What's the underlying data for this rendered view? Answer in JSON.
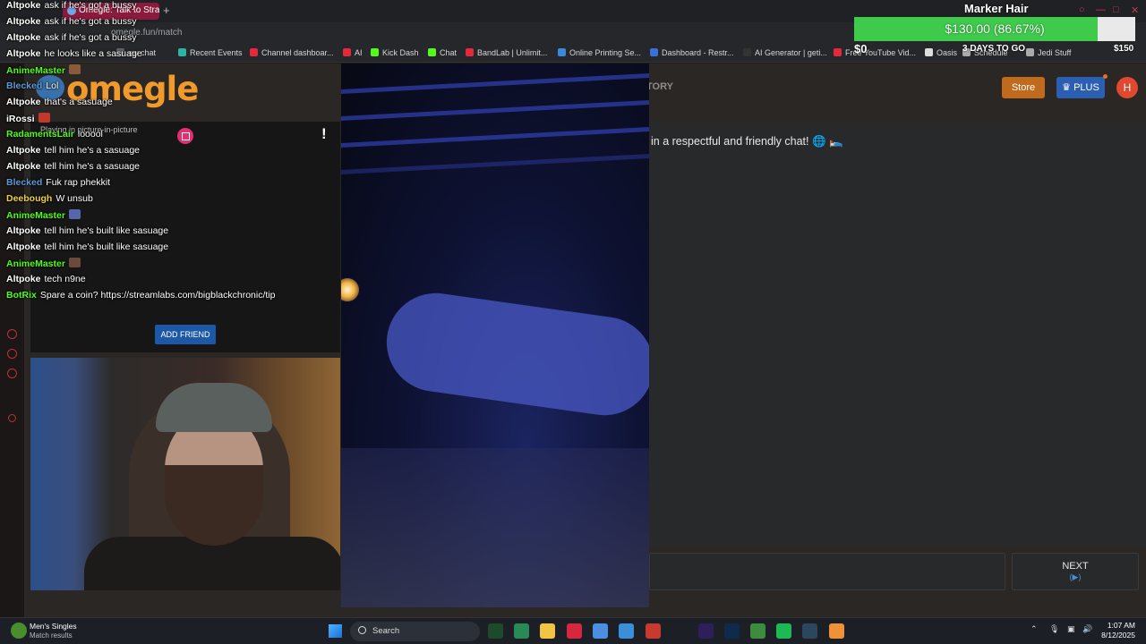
{
  "browser": {
    "tab_title": "Omegle: Talk to Strang",
    "new_tab": "+",
    "url": "omegle.fun/match",
    "bookmarks": [
      {
        "label": "ew chat",
        "icon_color": "#5f6368"
      },
      {
        "label": "Recent Events",
        "icon_color": "#2bb3a5"
      },
      {
        "label": "Channel dashboar...",
        "icon_color": "#e5283e"
      },
      {
        "label": "AI",
        "icon_color": "#e5283e"
      },
      {
        "label": "Kick Dash",
        "icon_color": "#53fc18"
      },
      {
        "label": "Chat",
        "icon_color": "#53fc18"
      },
      {
        "label": "BandLab | Unlimit...",
        "icon_color": "#e5283e"
      },
      {
        "label": "Online Printing Se...",
        "icon_color": "#3b87d8"
      },
      {
        "label": "Dashboard - Restr...",
        "icon_color": "#3b6fd8"
      },
      {
        "label": "AI Generator | geti...",
        "icon_color": "#333333"
      },
      {
        "label": "Free YouTube Vid...",
        "icon_color": "#e5283e"
      },
      {
        "label": "Oasis",
        "icon_color": "#dddddd"
      },
      {
        "label": "Schedule",
        "icon_color": "#aaaaaa"
      },
      {
        "label": "Jedi Stuff",
        "icon_color": "#aaaaaa"
      }
    ]
  },
  "site": {
    "logo": "omegle",
    "nav_partial": "TORY",
    "store_label": "Store",
    "plus_label": "PLUS",
    "avatar_initial": "H",
    "welcome_text": "in a respectful and friendly chat! 🌐 🛌",
    "pip_label": "Playing in picture-in-picture",
    "alert_glyph": "!",
    "add_friend_label": "ADD FRIEND",
    "next_label": "NEXT",
    "next_sub": "(▶)"
  },
  "goal": {
    "title": "Marker Hair",
    "amount_text": "$130.00 (86.67%)",
    "progress_percent": 86.67,
    "min_label": "$0",
    "days_label": "3 DAYS TO GO",
    "max_label": "$150",
    "fill_color": "#3ecb4c"
  },
  "overlay_chat": [
    {
      "user": "Altpoke",
      "msg": "ask if he's got a bussy",
      "color": "#ffffff",
      "emote": ""
    },
    {
      "user": "Altpoke",
      "msg": "ask if he's got a bussy",
      "color": "#ffffff",
      "emote": ""
    },
    {
      "user": "Altpoke",
      "msg": "ask if he's got a bussy",
      "color": "#ffffff",
      "emote": ""
    },
    {
      "user": "Altpoke",
      "msg": "he looks like a sasuage",
      "color": "#ffffff",
      "emote": ""
    },
    {
      "user": "AnimeMaster",
      "msg": "",
      "color": "#53fc18",
      "emote": "#8a5a3a"
    },
    {
      "user": "Blecked",
      "msg": "Lol",
      "color": "#5b9bd5",
      "emote": ""
    },
    {
      "user": "Altpoke",
      "msg": "that's a sasuage",
      "color": "#ffffff",
      "emote": ""
    },
    {
      "user": "iRossi",
      "msg": "",
      "color": "#ffffff",
      "emote": "#c0392b"
    },
    {
      "user": "RadamentsLair",
      "msg": "looool",
      "color": "#53fc18",
      "emote": ""
    },
    {
      "user": "Altpoke",
      "msg": "tell him he's a sasuage",
      "color": "#ffffff",
      "emote": ""
    },
    {
      "user": "Altpoke",
      "msg": "tell him he's a sasuage",
      "color": "#ffffff",
      "emote": ""
    },
    {
      "user": "Blecked",
      "msg": "Fuk rap phekkit",
      "color": "#5b9bd5",
      "emote": ""
    },
    {
      "user": "Deebough",
      "msg": "W unsub",
      "color": "#f0d040",
      "emote": ""
    },
    {
      "user": "AnimeMaster",
      "msg": "",
      "color": "#53fc18",
      "emote": "#5566aa"
    },
    {
      "user": "Altpoke",
      "msg": "tell him he's built like sasuage",
      "color": "#ffffff",
      "emote": ""
    },
    {
      "user": "Altpoke",
      "msg": "tell him he's built like sasuage",
      "color": "#ffffff",
      "emote": ""
    },
    {
      "user": "AnimeMaster",
      "msg": "",
      "color": "#53fc18",
      "emote": "#6a4a3a"
    },
    {
      "user": "Altpoke",
      "msg": "tech n9ne",
      "color": "#ffffff",
      "emote": ""
    },
    {
      "user": "BotRix",
      "msg": "Spare a coin? https://streamlabs.com/bigblackchronic/tip",
      "color": "#53fc18",
      "emote": ""
    }
  ],
  "taskbar": {
    "news_title": "Men's Singles",
    "news_sub": "Match results",
    "search_label": "Search",
    "apps": [
      {
        "name": "audition",
        "color": "#1d4a2a"
      },
      {
        "name": "files",
        "color": "#2a8a55"
      },
      {
        "name": "explorer",
        "color": "#f2c443"
      },
      {
        "name": "opera",
        "color": "#d6273f"
      },
      {
        "name": "chrome",
        "color": "#4a8fe0"
      },
      {
        "name": "photos",
        "color": "#3b8fd8"
      },
      {
        "name": "calendar",
        "color": "#c8392e"
      },
      {
        "name": "premiere",
        "color": "#2c1f5a"
      },
      {
        "name": "photoshop",
        "color": "#0f2a4a"
      },
      {
        "name": "xbox",
        "color": "#3d8c3d"
      },
      {
        "name": "spotify",
        "color": "#1db954"
      },
      {
        "name": "steam",
        "color": "#2a475e"
      },
      {
        "name": "discord",
        "color": "#f0913a"
      }
    ],
    "time": "1:07 AM",
    "date": "8/12/2025"
  }
}
